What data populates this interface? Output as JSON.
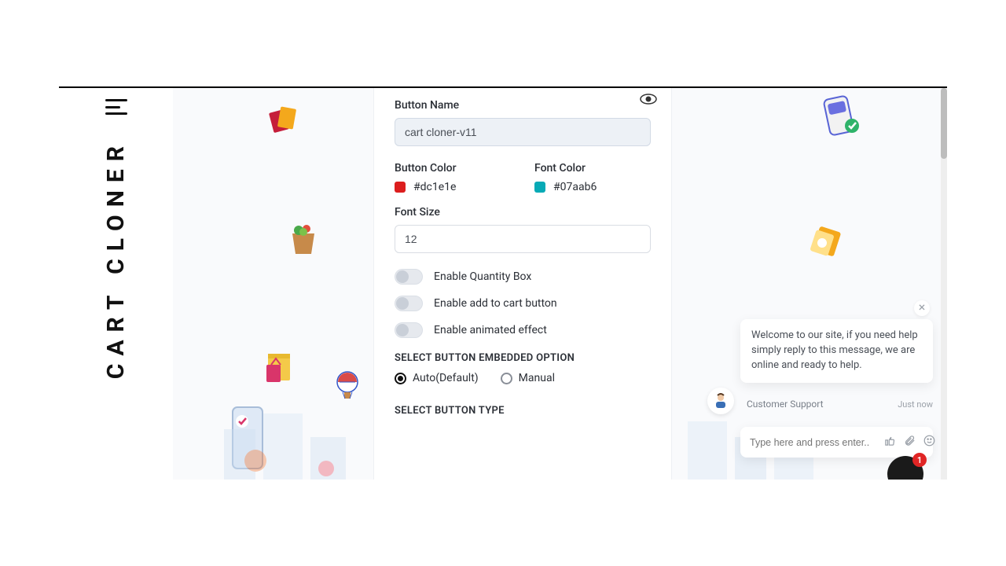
{
  "brand": "CART CLONER",
  "form": {
    "button_name_label": "Button Name",
    "button_name_value": "cart cloner-v11",
    "button_color_label": "Button Color",
    "button_color_value": "#dc1e1e",
    "font_color_label": "Font Color",
    "font_color_value": "#07aab6",
    "font_size_label": "Font Size",
    "font_size_value": "12",
    "toggles": {
      "quantity": "Enable Quantity Box",
      "addtocart": "Enable add to cart button",
      "animated": "Enable animated effect"
    },
    "embed_title": "SELECT BUTTON EMBEDDED OPTION",
    "embed_auto": "Auto(Default)",
    "embed_manual": "Manual",
    "type_title": "SELECT BUTTON TYPE"
  },
  "chat": {
    "message": "Welcome to our site, if you need help simply reply to this message, we are online and ready to help.",
    "agent": "Customer Support",
    "time": "Just now",
    "placeholder": "Type here and press enter..",
    "badge": "1"
  }
}
